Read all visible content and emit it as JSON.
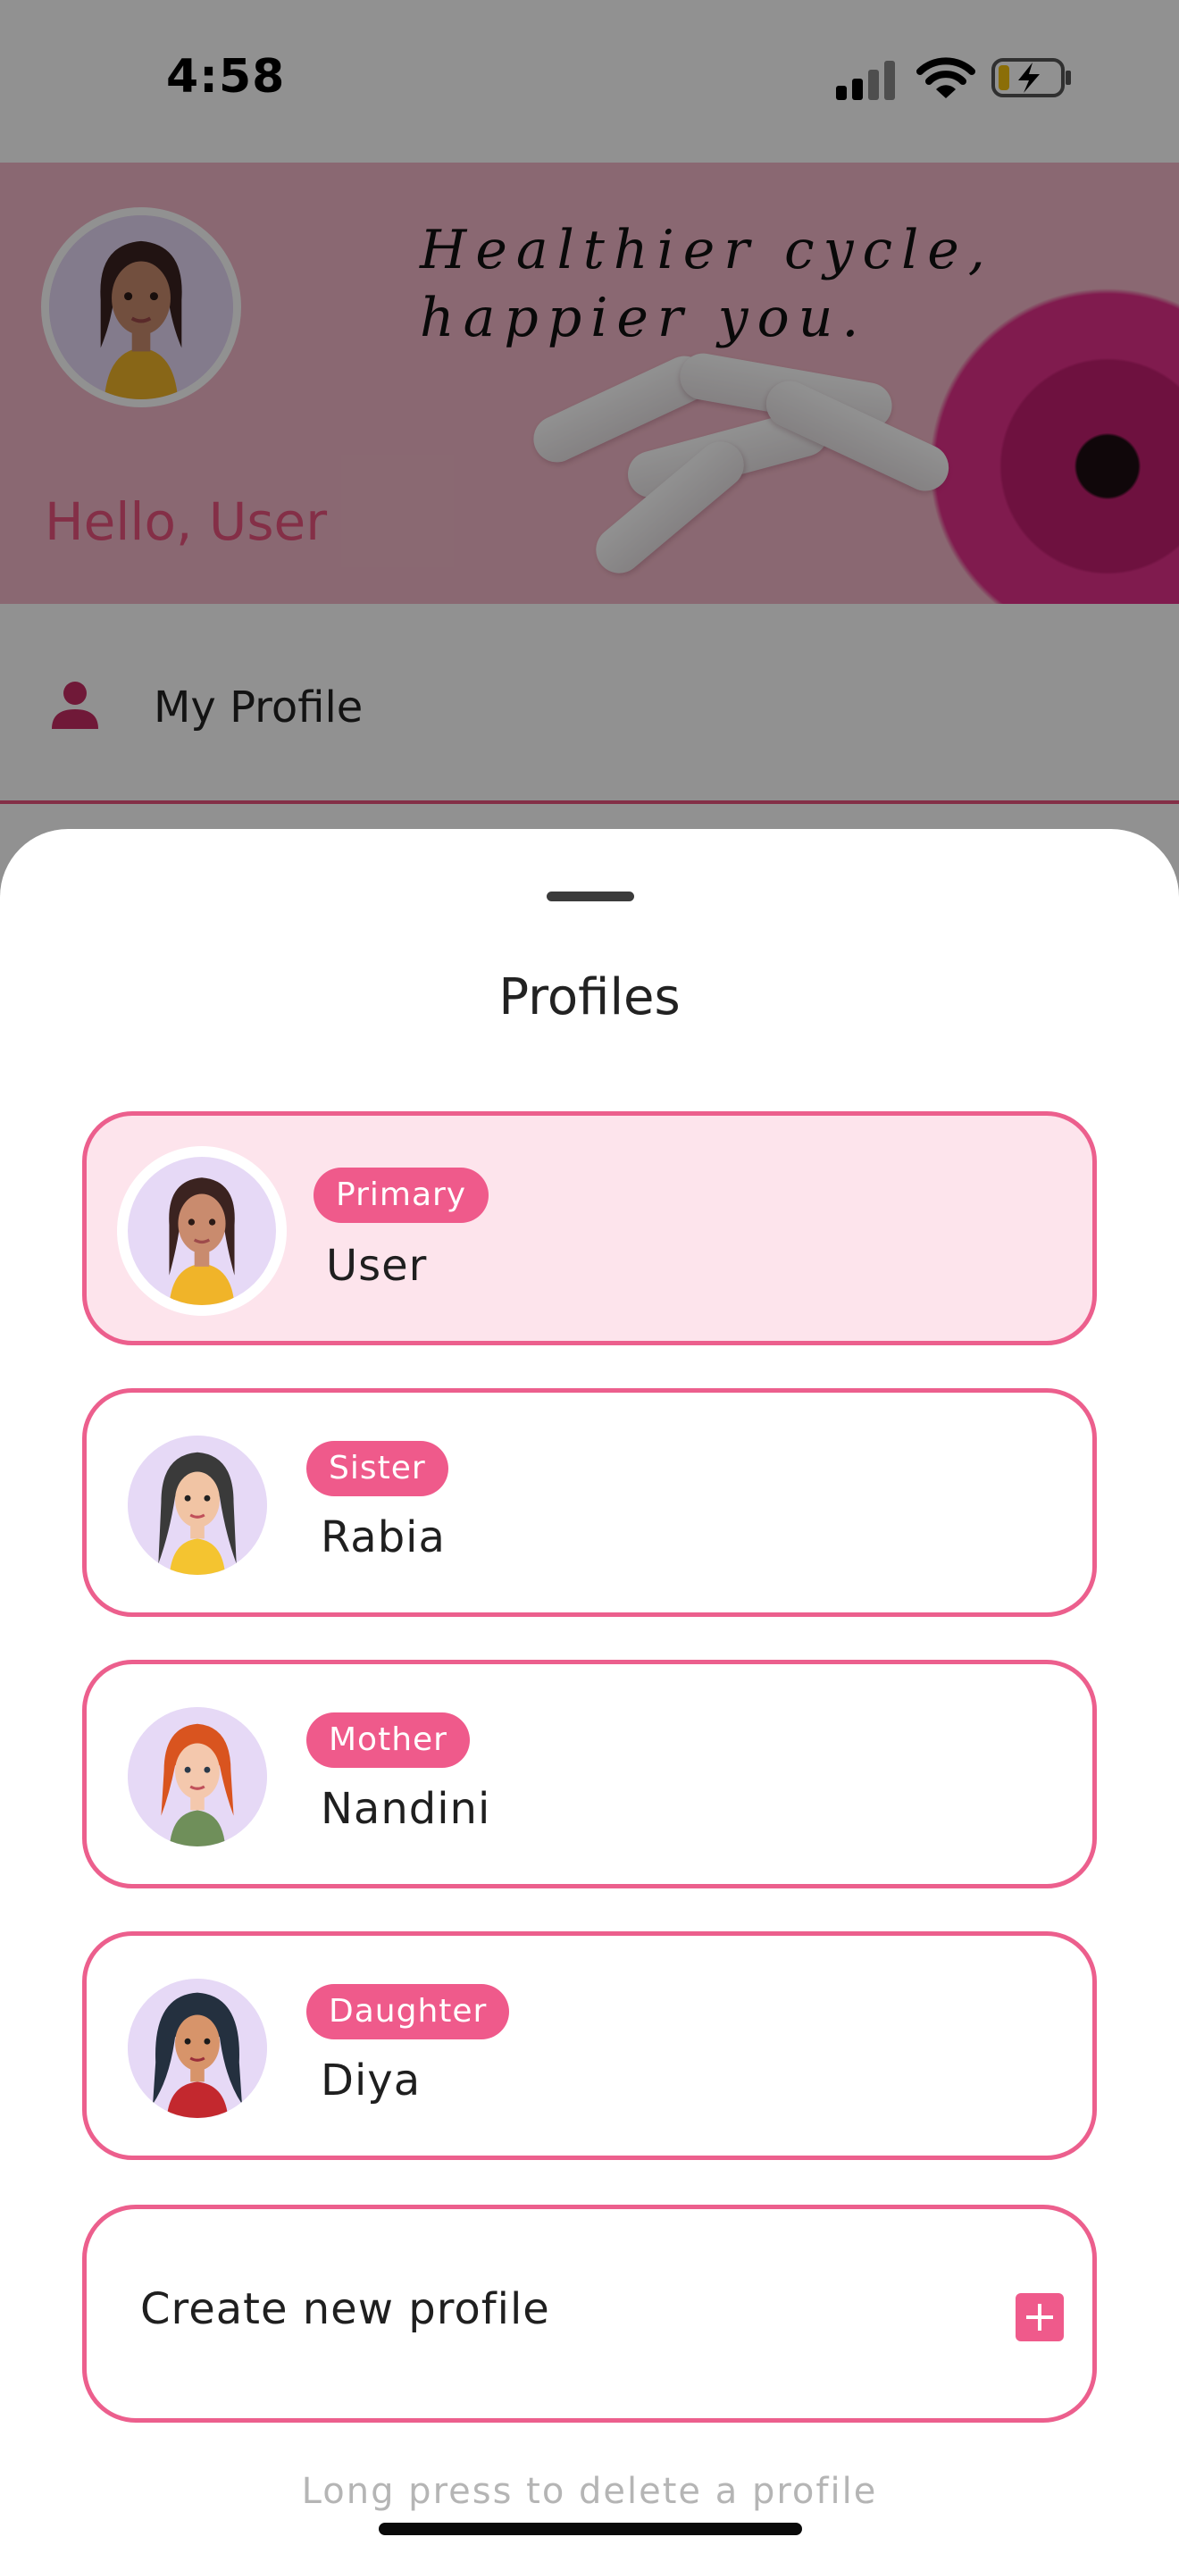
{
  "status_bar": {
    "time": "4:58"
  },
  "banner": {
    "tagline_line1": "Healthier cycle,",
    "tagline_line2": "happier you.",
    "greeting": "Hello, User"
  },
  "menu": {
    "my_profile": "My Profile"
  },
  "sheet": {
    "title": "Profiles",
    "profiles": [
      {
        "relation": "Primary",
        "name": "User"
      },
      {
        "relation": "Sister",
        "name": "Rabia"
      },
      {
        "relation": "Mother",
        "name": "Nandini"
      },
      {
        "relation": "Daughter",
        "name": "Diya"
      }
    ],
    "create_label": "Create new profile",
    "hint": "Long press to delete a profile"
  },
  "colors": {
    "accent": "#ef5a8b",
    "primary_card_bg": "#fde4ec",
    "avatar_bg": "#e6d9f6"
  },
  "icons": {
    "menu_profile": "person-icon",
    "create": "plus-icon",
    "status": [
      "signal-icon",
      "wifi-icon",
      "battery-charging-icon"
    ]
  }
}
